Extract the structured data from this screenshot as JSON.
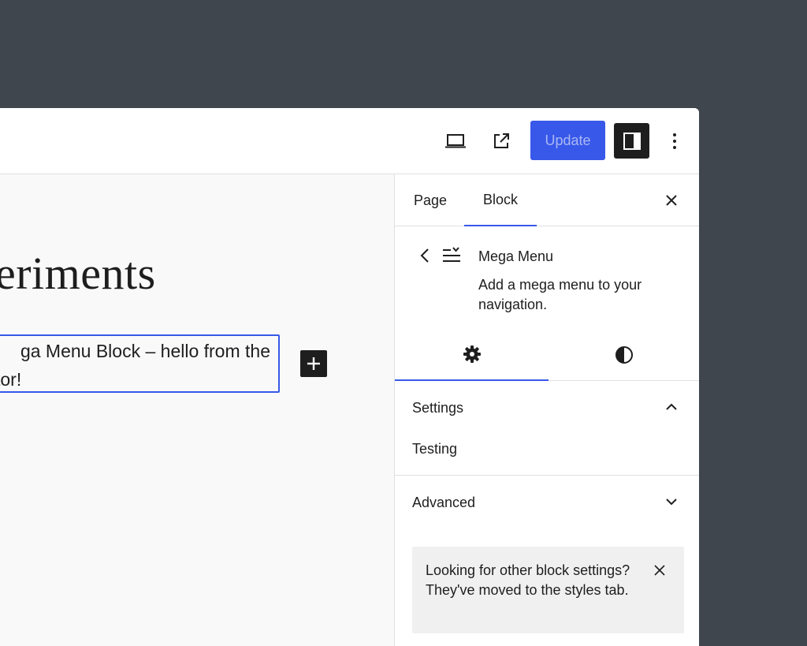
{
  "topbar": {
    "update_label": "Update"
  },
  "canvas": {
    "heading": "eriments",
    "block_line1": "ga Menu Block – hello from the",
    "block_line2": "tor!"
  },
  "sidebar": {
    "tabs": [
      {
        "label": "Page"
      },
      {
        "label": "Block"
      }
    ],
    "block_card": {
      "title": "Mega Menu",
      "description": "Add a mega menu to your navigation."
    },
    "panels": {
      "settings_title": "Settings",
      "settings_body": "Testing",
      "advanced_title": "Advanced"
    },
    "notice": "Looking for other block settings? They've moved to the styles tab."
  },
  "colors": {
    "accent": "#3858e9",
    "backdrop": "#40464d",
    "canvas_bg": "#f9f9f9",
    "notice_bg": "#f0f0f0"
  },
  "icons": {
    "desktop_preview": "laptop-icon",
    "view_external": "external-link-icon",
    "sidebar_toggle": "sidebar-panel-icon",
    "options": "more-vertical-icon",
    "close": "close-icon",
    "back": "chevron-left-icon",
    "block": "menu-list-icon",
    "settings_tab": "gear-icon",
    "styles_tab": "contrast-icon",
    "add_block": "plus-icon"
  }
}
